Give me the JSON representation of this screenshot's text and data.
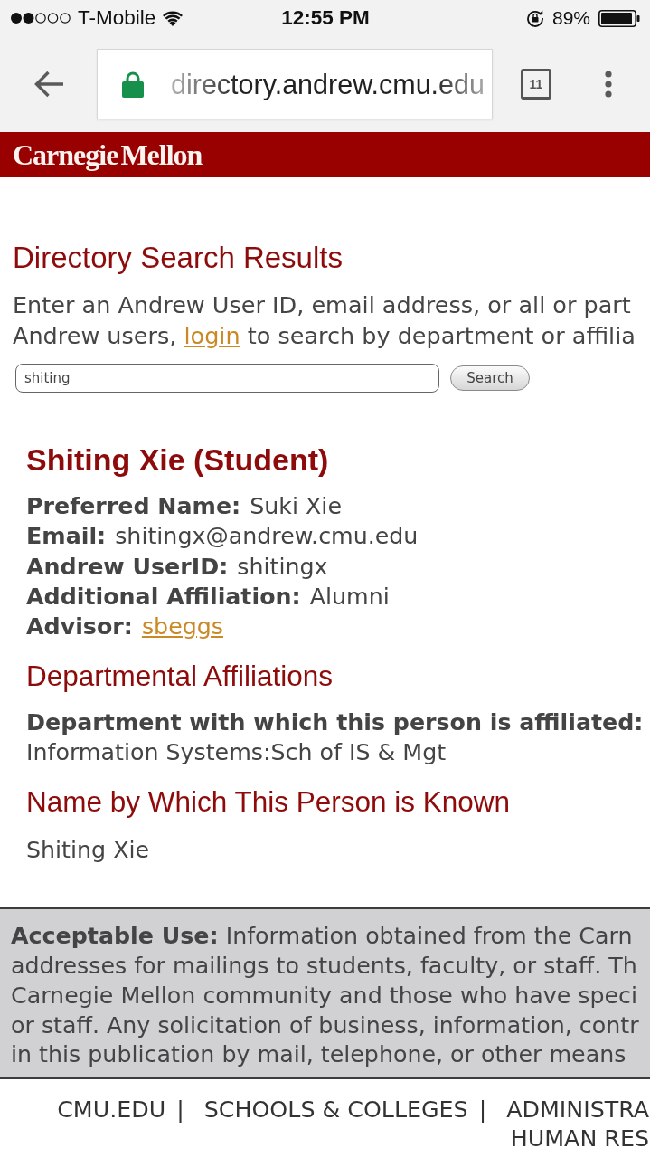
{
  "status_bar": {
    "carrier": "T-Mobile",
    "time": "12:55 PM",
    "battery": "89%"
  },
  "browser": {
    "url": "directory.andrew.cmu.edu",
    "tab_count": "11"
  },
  "header": {
    "logo": "Carnegie Mellon"
  },
  "page": {
    "title": "Directory Search Results",
    "intro": {
      "line_1": "Enter an Andrew User ID, email address, or all or part",
      "line_2_start": "Andrew users,",
      "link": "login",
      "line_2_end": "to search by department or affilia"
    },
    "search": {
      "value": "shiting",
      "button": "Search"
    }
  },
  "result": {
    "name": "Shiting Xie (Student)",
    "fields": [
      {
        "label": "Preferred Name:",
        "value": "Suki Xie",
        "kind": "text"
      },
      {
        "label": "Email:",
        "value": "shitingx@andrew.cmu.edu",
        "kind": "text"
      },
      {
        "label": "Andrew UserID:",
        "value": "shitingx",
        "kind": "text"
      },
      {
        "label": "Additional Affiliation:",
        "value": "Alumni",
        "kind": "text"
      },
      {
        "label": "Advisor:",
        "value": "sbeggs",
        "kind": "link"
      }
    ],
    "sections": [
      {
        "title": "Departmental Affiliations",
        "label": "Department with which this person is affiliated:",
        "value": "Information Systems:Sch of IS & Mgt"
      },
      {
        "title": "Name by Which This Person is Known",
        "value": "Shiting Xie"
      }
    ]
  },
  "acceptable_use": {
    "lines": [
      "**Acceptable Use:** Information obtained from the Carn",
      "addresses for mailings to students, faculty, or staff. Th",
      "Carnegie Mellon community and those who have speci",
      "or staff. Any solicitation of business, information, contr",
      "in this publication by mail, telephone, or other means"
    ]
  },
  "footer_nav": {
    "items": [
      {
        "kind": "link",
        "text": "CMU.EDU"
      },
      {
        "kind": "separator",
        "text": "|"
      },
      {
        "kind": "link",
        "text": "SCHOOLS & COLLEGES"
      },
      {
        "kind": "separator",
        "text": "|"
      },
      {
        "kind": "link",
        "text": "ADMINISTRA"
      },
      {
        "kind": "link",
        "text": "HUMAN RES"
      }
    ]
  }
}
